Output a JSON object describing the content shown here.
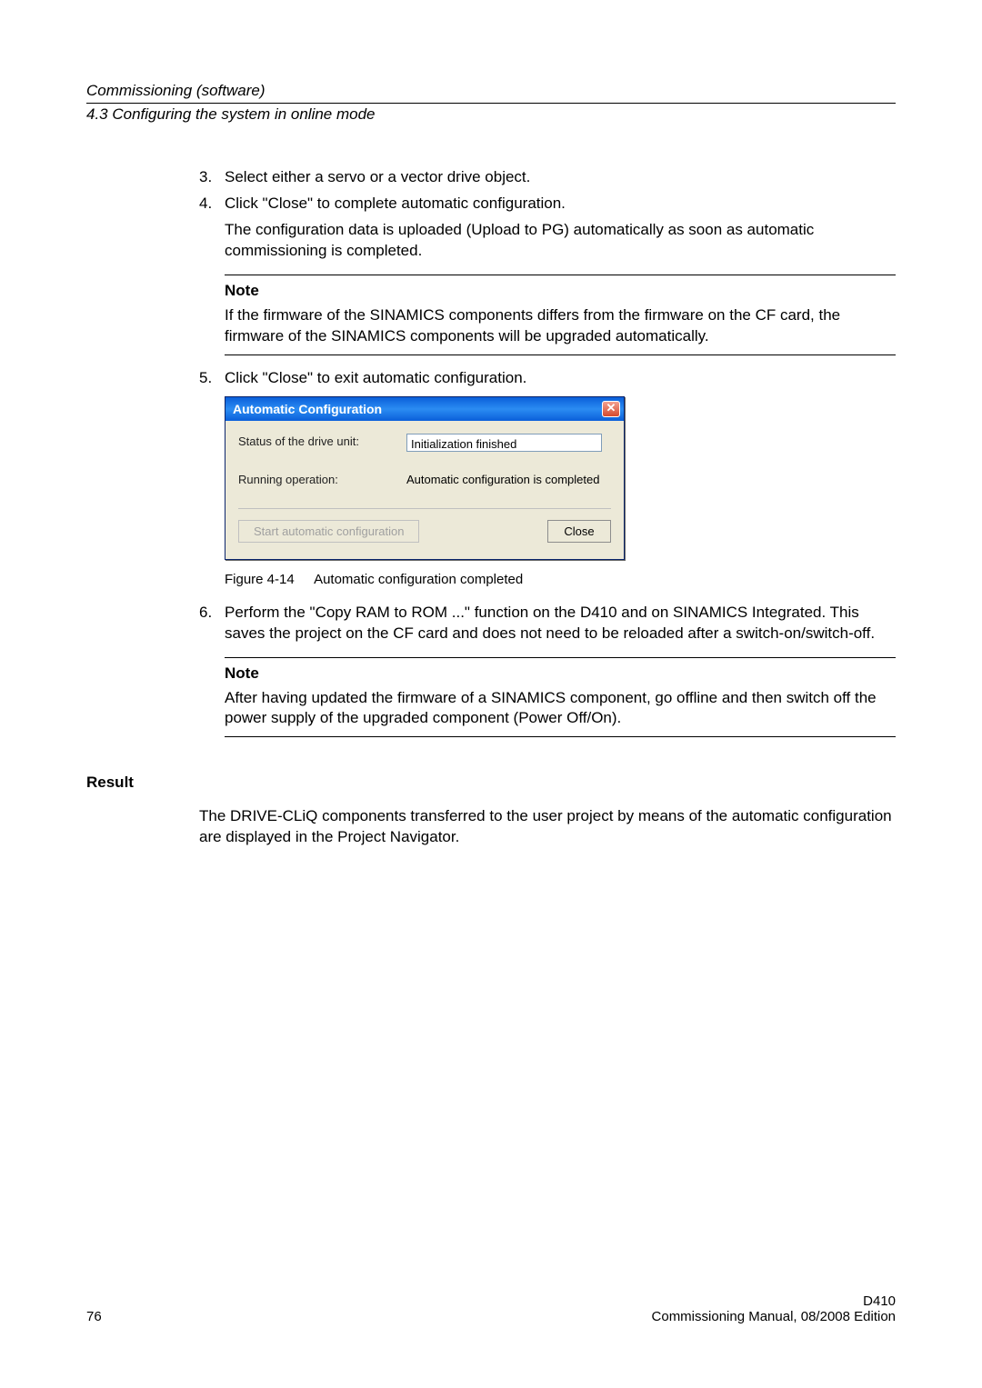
{
  "header": {
    "title": "Commissioning (software)",
    "subtitle": "4.3 Configuring the system in online mode"
  },
  "steps": {
    "s3": {
      "num": "3.",
      "text": "Select either a servo or a vector drive object."
    },
    "s4": {
      "num": "4.",
      "text": "Click \"Close\" to complete automatic configuration.",
      "sub": "The configuration data is uploaded (Upload to PG) automatically as soon as automatic commissioning is completed."
    },
    "note1": {
      "title": "Note",
      "text": "If the firmware of the SINAMICS components differs from the firmware on the CF card, the firmware of the SINAMICS components will be upgraded automatically."
    },
    "s5": {
      "num": "5.",
      "text": "Click \"Close\" to exit automatic configuration."
    },
    "s6": {
      "num": "6.",
      "text": "Perform the \"Copy RAM to ROM ...\" function on the D410 and on SINAMICS Integrated. This saves the project on the CF card and does not need to be reloaded after a switch-on/switch-off."
    },
    "note2": {
      "title": "Note",
      "text": "After having updated the firmware of a SINAMICS component, go offline and then switch off the power supply of the upgraded component (Power Off/On)."
    }
  },
  "dialog": {
    "title": "Automatic Configuration",
    "close_glyph": "✕",
    "row1_label": "Status of the drive unit:",
    "row1_value": "Initialization finished",
    "row2_label": "Running operation:",
    "row2_value": "Automatic configuration is completed",
    "btn_start": "Start automatic configuration",
    "btn_close": "Close"
  },
  "figure": {
    "num": "Figure 4-14",
    "caption": "Automatic configuration completed"
  },
  "result": {
    "heading": "Result",
    "text": "The DRIVE-CLiQ components transferred to the user project by means of the automatic configuration are displayed in the Project Navigator."
  },
  "footer": {
    "page": "76",
    "doc1": "D410",
    "doc2": "Commissioning Manual, 08/2008 Edition"
  }
}
